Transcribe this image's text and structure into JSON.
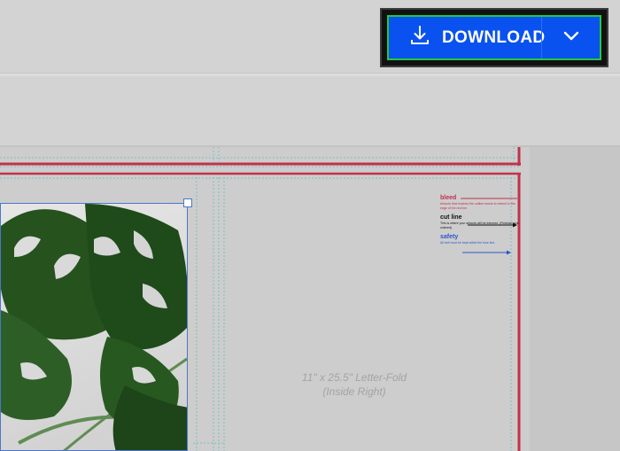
{
  "toolbar": {
    "download_label": "DOWNLOAD",
    "icons": {
      "download": "download-icon",
      "dropdown": "chevron-down-icon"
    },
    "accent_color": "#0a52f0",
    "highlight_color": "#25c83f"
  },
  "template": {
    "caption_line1": "11\" x 25.5\" Letter-Fold",
    "caption_line2": "(Inside Right)"
  },
  "legend": {
    "bleed": {
      "title": "bleed",
      "desc": "Artwork that reaches the outline needs to extend to the edge of the red line.",
      "color": "#c2314b"
    },
    "cut_line": {
      "title": "cut line",
      "desc": "This is where your artwork will be trimmed. (Finished size ordered)",
      "color": "#111111"
    },
    "safety": {
      "title": "safety",
      "desc": "All text must be kept within the blue line.",
      "color": "#2a58c8"
    }
  }
}
